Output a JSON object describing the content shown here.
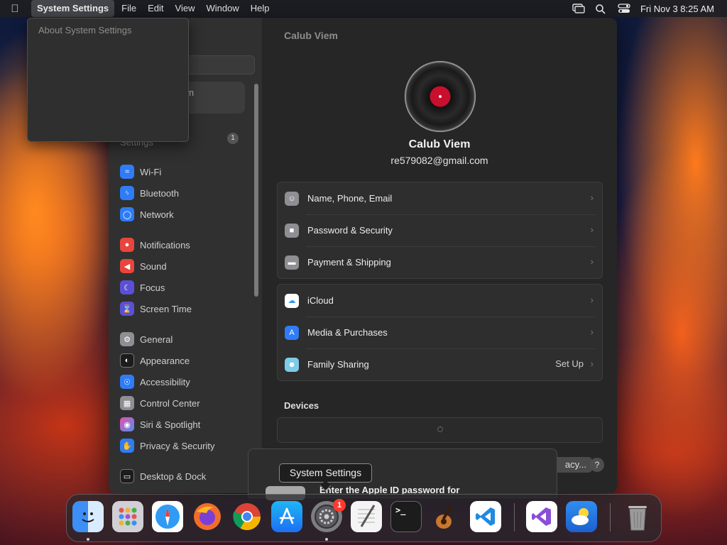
{
  "menubar": {
    "apple_icon": "apple-logo-icon",
    "app_name": "System Settings",
    "menus": [
      "File",
      "Edit",
      "View",
      "Window",
      "Help"
    ],
    "datetime": "Fri Nov 3  8:25 AM",
    "status_icons": [
      "screen-mirroring-icon",
      "spotlight-search-icon",
      "control-center-icon"
    ]
  },
  "dropdown": {
    "items": [
      "About System Settings"
    ]
  },
  "sidebar": {
    "profile_partial_label": "em",
    "suggestion_label": "Settings",
    "suggestion_badge": "1",
    "items": [
      {
        "label": "Wi-Fi",
        "icon": "wifi-icon",
        "color": "#2f7cf6"
      },
      {
        "label": "Bluetooth",
        "icon": "bluetooth-icon",
        "color": "#2f7cf6"
      },
      {
        "label": "Network",
        "icon": "globe-icon",
        "color": "#2f7cf6"
      },
      {
        "label": "Notifications",
        "icon": "bell-icon",
        "color": "#e8453c"
      },
      {
        "label": "Sound",
        "icon": "speaker-icon",
        "color": "#e8453c"
      },
      {
        "label": "Focus",
        "icon": "moon-icon",
        "color": "#5b4fd6"
      },
      {
        "label": "Screen Time",
        "icon": "hourglass-icon",
        "color": "#5b4fd6"
      },
      {
        "label": "General",
        "icon": "gear-icon",
        "color": "#8e8e93"
      },
      {
        "label": "Appearance",
        "icon": "appearance-icon",
        "color": "#1c1c1e"
      },
      {
        "label": "Accessibility",
        "icon": "accessibility-icon",
        "color": "#2f7cf6"
      },
      {
        "label": "Control Center",
        "icon": "control-center-icon",
        "color": "#8e8e93"
      },
      {
        "label": "Siri & Spotlight",
        "icon": "siri-icon",
        "color": "#b44fd6"
      },
      {
        "label": "Privacy & Security",
        "icon": "hand-icon",
        "color": "#2f7cf6"
      },
      {
        "label": "Desktop & Dock",
        "icon": "dock-icon",
        "color": "#1c1c1e"
      }
    ]
  },
  "main": {
    "title": "Calub Viem",
    "user_name": "Calub Viem",
    "user_email": "re579082@gmail.com",
    "group1": [
      {
        "label": "Name, Phone, Email",
        "icon": "person-icon",
        "color": "#8e8e93"
      },
      {
        "label": "Password & Security",
        "icon": "lock-icon",
        "color": "#8e8e93"
      },
      {
        "label": "Payment & Shipping",
        "icon": "credit-card-icon",
        "color": "#8e8e93"
      }
    ],
    "group2": [
      {
        "label": "iCloud",
        "icon": "icloud-icon",
        "color": "#ffffff",
        "extra": ""
      },
      {
        "label": "Media & Purchases",
        "icon": "app-store-icon",
        "color": "#2f7cf6",
        "extra": ""
      },
      {
        "label": "Family Sharing",
        "icon": "family-icon",
        "color": "#7ecbe8",
        "extra": "Set Up"
      }
    ],
    "devices_title": "Devices",
    "privacy_button": "acy...",
    "help_button": "?"
  },
  "sheet": {
    "text": "Enter the Apple ID password for"
  },
  "tooltip": {
    "text": "System Settings"
  },
  "dock": {
    "items": [
      {
        "name": "Finder",
        "icon": "finder-icon",
        "color": "#3d8ef5",
        "running": true
      },
      {
        "name": "Launchpad",
        "icon": "launchpad-icon",
        "color": "#c9c9cf",
        "running": false
      },
      {
        "name": "Safari",
        "icon": "safari-icon",
        "color": "#2f9bf5",
        "running": false
      },
      {
        "name": "Firefox",
        "icon": "firefox-icon",
        "color": "#f26d2b",
        "running": false
      },
      {
        "name": "Chrome",
        "icon": "chrome-icon",
        "color": "#e8e8e8",
        "running": false
      },
      {
        "name": "App Store",
        "icon": "app-store-icon",
        "color": "#1d8cf2",
        "running": false
      },
      {
        "name": "System Settings",
        "icon": "system-settings-icon",
        "color": "#8a8a8f",
        "running": true,
        "badge": "1"
      },
      {
        "name": "TextEdit",
        "icon": "textedit-icon",
        "color": "#f0f0f0",
        "running": false
      },
      {
        "name": "Terminal",
        "icon": "terminal-icon",
        "color": "#1f1f1f",
        "running": false
      },
      {
        "name": "GarageBand",
        "icon": "garageband-icon",
        "color": "#8a4b1c",
        "running": false
      },
      {
        "name": "Visual Studio Code",
        "icon": "vscode-icon",
        "color": "#ffffff",
        "running": false
      },
      {
        "name": "Visual Studio",
        "icon": "visual-studio-icon",
        "color": "#ffffff",
        "running": false
      },
      {
        "name": "Weather",
        "icon": "weather-icon",
        "color": "#2f7ee6",
        "running": false
      },
      {
        "name": "Trash",
        "icon": "trash-icon",
        "color": "#9a9a9a",
        "running": false
      }
    ]
  }
}
